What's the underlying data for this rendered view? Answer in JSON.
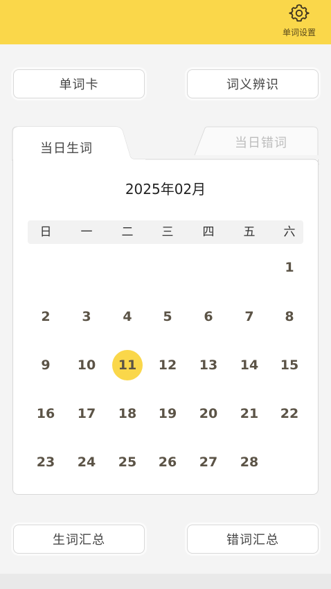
{
  "header": {
    "settings_label": "单词设置",
    "settings_icon": "gear-icon",
    "bar_color": "#fad74a"
  },
  "top_buttons": {
    "word_card": "单词卡",
    "meaning_identify": "词义辨识"
  },
  "tabs": {
    "active": "当日生词",
    "inactive": "当日错词"
  },
  "calendar": {
    "month_title": "2025年02月",
    "weekdays": [
      "日",
      "一",
      "二",
      "三",
      "四",
      "五",
      "六"
    ],
    "selected_day": "11",
    "selected_color": "#fad74a",
    "days": [
      "1",
      "2",
      "3",
      "4",
      "5",
      "6",
      "7",
      "8",
      "9",
      "10",
      "11",
      "12",
      "13",
      "14",
      "15",
      "16",
      "17",
      "18",
      "19",
      "20",
      "21",
      "22",
      "23",
      "24",
      "25",
      "26",
      "27",
      "28"
    ]
  },
  "bottom_buttons": {
    "new_words_summary": "生词汇总",
    "wrong_words_summary": "错词汇总"
  }
}
